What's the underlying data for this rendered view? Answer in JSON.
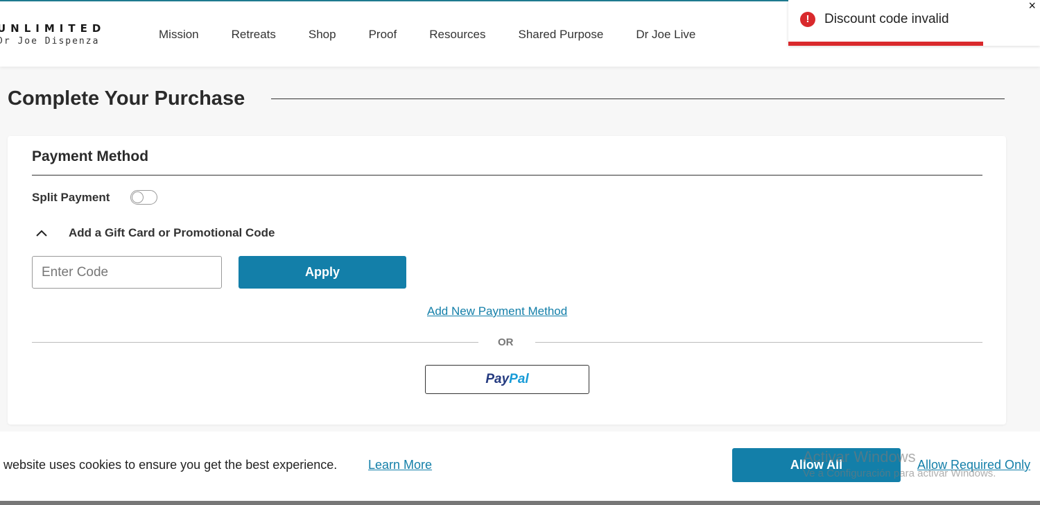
{
  "header": {
    "logo_top": "UNLIMITED",
    "logo_bottom": "Dr Joe Dispenza",
    "nav": [
      "Mission",
      "Retreats",
      "Shop",
      "Proof",
      "Resources",
      "Shared Purpose",
      "Dr Joe Live"
    ]
  },
  "toast": {
    "icon": "!",
    "message": "Discount code invalid",
    "close": "×",
    "color": "#d9292c"
  },
  "page": {
    "title": "Complete Your Purchase"
  },
  "payment": {
    "title": "Payment Method",
    "split_label": "Split Payment",
    "split_enabled": false,
    "gift_label": "Add a Gift Card or Promotional Code",
    "code_placeholder": "Enter Code",
    "code_value": "",
    "apply_label": "Apply",
    "add_method_label": "Add New Payment Method",
    "or_label": "OR",
    "paypal_part1": "Pay",
    "paypal_part2": "Pal"
  },
  "cookie": {
    "text": "website uses cookies to ensure you get the best experience.",
    "learn_more": "Learn More",
    "allow_all": "Allow All",
    "allow_required": "Allow Required Only"
  },
  "watermark": {
    "title": "Activar Windows",
    "subtitle": "Ve a Configuración para activar Windows."
  },
  "colors": {
    "accent": "#137fa9",
    "error": "#d9292c"
  }
}
